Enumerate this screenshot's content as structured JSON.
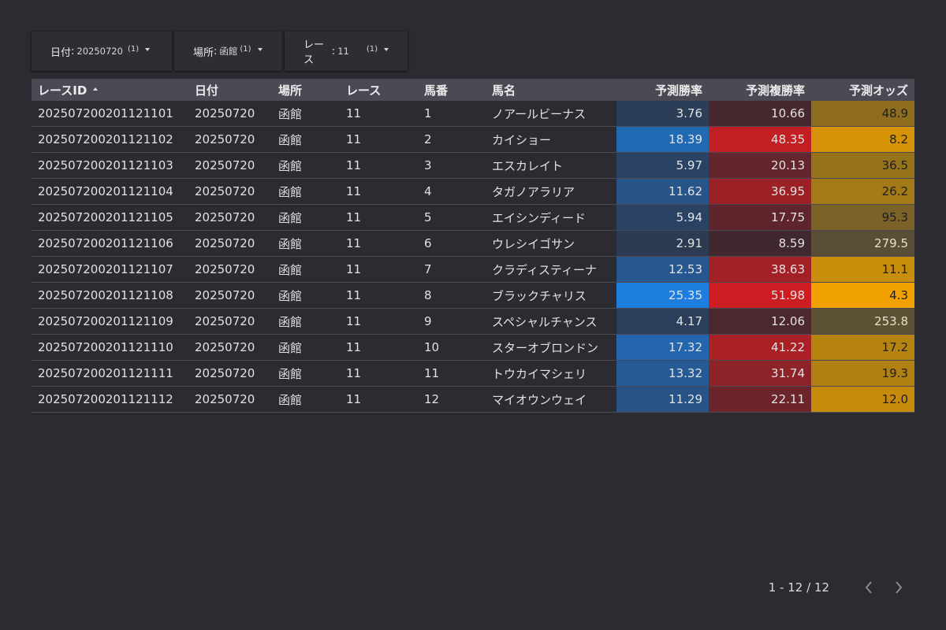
{
  "filters": [
    {
      "label": "日付",
      "value": "20250720",
      "count": "(1)"
    },
    {
      "label": "場所",
      "value": "函館",
      "count": "(1)"
    },
    {
      "label": "レース",
      "value": "11",
      "count": "(1)"
    }
  ],
  "table": {
    "headers": [
      "レースID",
      "日付",
      "場所",
      "レース",
      "馬番",
      "馬名",
      "予測勝率",
      "予測複勝率",
      "予測オッズ"
    ],
    "sort_indicator": "ascending",
    "rows": [
      {
        "id": "202507200201121101",
        "date": "20250720",
        "place": "函館",
        "race": "11",
        "num": "1",
        "name": "ノアールビーナス",
        "win": "3.76",
        "place_rate": "10.66",
        "odds": "48.9"
      },
      {
        "id": "202507200201121102",
        "date": "20250720",
        "place": "函館",
        "race": "11",
        "num": "2",
        "name": "カイショー",
        "win": "18.39",
        "place_rate": "48.35",
        "odds": "8.2"
      },
      {
        "id": "202507200201121103",
        "date": "20250720",
        "place": "函館",
        "race": "11",
        "num": "3",
        "name": "エスカレイト",
        "win": "5.97",
        "place_rate": "20.13",
        "odds": "36.5"
      },
      {
        "id": "202507200201121104",
        "date": "20250720",
        "place": "函館",
        "race": "11",
        "num": "4",
        "name": "タガノアラリア",
        "win": "11.62",
        "place_rate": "36.95",
        "odds": "26.2"
      },
      {
        "id": "202507200201121105",
        "date": "20250720",
        "place": "函館",
        "race": "11",
        "num": "5",
        "name": "エイシンディード",
        "win": "5.94",
        "place_rate": "17.75",
        "odds": "95.3"
      },
      {
        "id": "202507200201121106",
        "date": "20250720",
        "place": "函館",
        "race": "11",
        "num": "6",
        "name": "ウレシイゴサン",
        "win": "2.91",
        "place_rate": "8.59",
        "odds": "279.5"
      },
      {
        "id": "202507200201121107",
        "date": "20250720",
        "place": "函館",
        "race": "11",
        "num": "7",
        "name": "クラディスティーナ",
        "win": "12.53",
        "place_rate": "38.63",
        "odds": "11.1"
      },
      {
        "id": "202507200201121108",
        "date": "20250720",
        "place": "函館",
        "race": "11",
        "num": "8",
        "name": "ブラックチャリス",
        "win": "25.35",
        "place_rate": "51.98",
        "odds": "4.3"
      },
      {
        "id": "202507200201121109",
        "date": "20250720",
        "place": "函館",
        "race": "11",
        "num": "9",
        "name": "スペシャルチャンス",
        "win": "4.17",
        "place_rate": "12.06",
        "odds": "253.8"
      },
      {
        "id": "202507200201121110",
        "date": "20250720",
        "place": "函館",
        "race": "11",
        "num": "10",
        "name": "スターオブロンドン",
        "win": "17.32",
        "place_rate": "41.22",
        "odds": "17.2"
      },
      {
        "id": "202507200201121111",
        "date": "20250720",
        "place": "函館",
        "race": "11",
        "num": "11",
        "name": "トウカイマシェリ",
        "win": "13.32",
        "place_rate": "31.74",
        "odds": "19.3"
      },
      {
        "id": "202507200201121112",
        "date": "20250720",
        "place": "函館",
        "race": "11",
        "num": "12",
        "name": "マイオウンウェイ",
        "win": "11.29",
        "place_rate": "22.11",
        "odds": "12.0"
      }
    ]
  },
  "heat_colors": {
    "win": {
      "low": "#2c3a52",
      "high": "#1e7ee0"
    },
    "place_rate": {
      "low": "#40282f",
      "high": "#cc1e22"
    },
    "odds": {
      "low": "#5a4f36",
      "mid": "#98731a",
      "high": "#f2a200"
    }
  },
  "pagination": {
    "text": "1 - 12 / 12",
    "prev_icon": "chevron-left-icon",
    "next_icon": "chevron-right-icon"
  },
  "colors": {
    "background": "#2c2b31",
    "header": "#4a4954",
    "row_border": "#4a4954"
  }
}
